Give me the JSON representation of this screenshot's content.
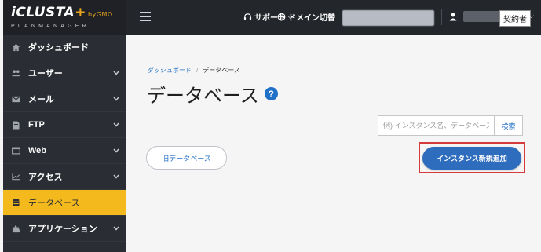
{
  "app": {
    "logo_main": "iCLUSTA",
    "logo_plus": "+",
    "logo_by": "byGMO",
    "logo_sub": "PLANMANAGER"
  },
  "topbar": {
    "support_label": "サポート",
    "domain_label": "ドメイン切替",
    "contract_label": "契約者"
  },
  "sidebar": {
    "items": [
      {
        "label": "ダッシュボード",
        "icon": "home-icon",
        "has_chevron": false,
        "active": false
      },
      {
        "label": "ユーザー",
        "icon": "users-icon",
        "has_chevron": true,
        "active": false
      },
      {
        "label": "メール",
        "icon": "mail-icon",
        "has_chevron": true,
        "active": false
      },
      {
        "label": "FTP",
        "icon": "file-icon",
        "has_chevron": true,
        "active": false
      },
      {
        "label": "Web",
        "icon": "window-icon",
        "has_chevron": true,
        "active": false
      },
      {
        "label": "アクセス",
        "icon": "chart-icon",
        "has_chevron": true,
        "active": false
      },
      {
        "label": "データベース",
        "icon": "database-icon",
        "has_chevron": false,
        "active": true
      },
      {
        "label": "アプリケーション",
        "icon": "puzzle-icon",
        "has_chevron": true,
        "active": false
      }
    ]
  },
  "breadcrumb": {
    "home": "ダッシュボード",
    "separator": "/",
    "current": "データベース"
  },
  "main": {
    "title": "データベース",
    "help_glyph": "?",
    "search_placeholder": "例) インスタンス名、データベース名",
    "search_button": "検索",
    "old_db_button": "旧データベース",
    "new_instance_button": "インスタンス新規追加"
  },
  "colors": {
    "sidebar_bg": "#2a2d33",
    "topbar_bg": "#23262b",
    "active_item": "#f4ba1d",
    "primary_blue": "#2e6cbd",
    "link_blue": "#1f6fc5",
    "highlight_red": "#d63a3a"
  }
}
